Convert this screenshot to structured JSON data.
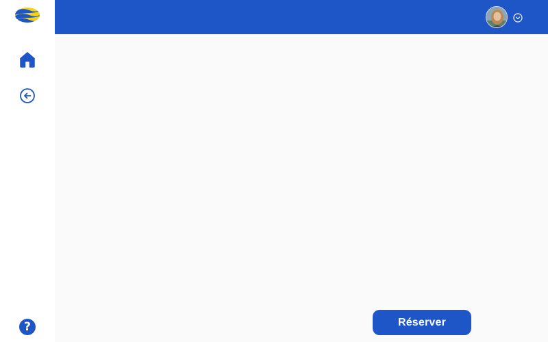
{
  "sidebar": {
    "logo_icon": "brand-logo-icon",
    "items": [
      {
        "icon": "home-icon"
      },
      {
        "icon": "arrow-left-circle-icon"
      }
    ],
    "help": {
      "label": "?",
      "icon": "help-icon"
    }
  },
  "topbar": {
    "avatar_icon": "user-avatar",
    "menu_icon": "chevron-down-circle-icon"
  },
  "main": {
    "reserve_label": "Réserver"
  },
  "colors": {
    "primary": "#1e55c7",
    "logo_yellow": "#f2d318",
    "content_bg": "#fafafa",
    "sidebar_bg": "#ffffff"
  }
}
